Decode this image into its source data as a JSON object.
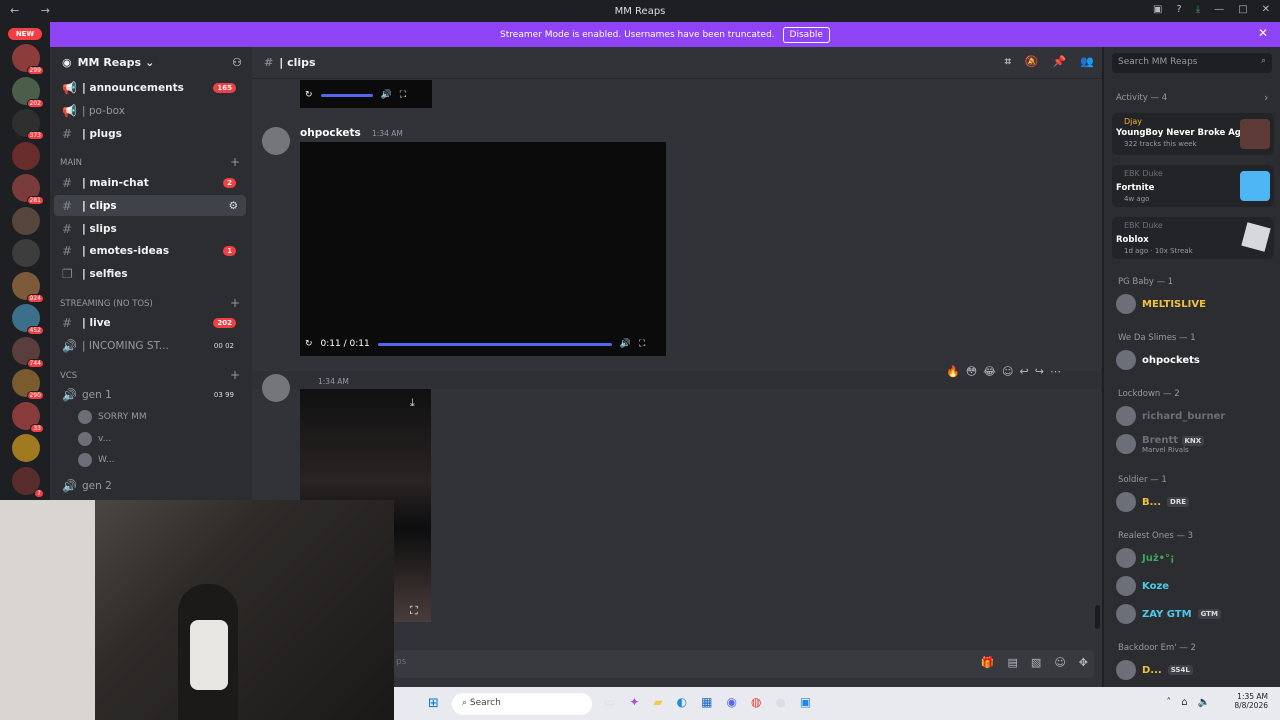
{
  "window": {
    "title": "MM Reaps",
    "nav": "← →"
  },
  "banner": {
    "text": "Streamer Mode is enabled. Usernames have been truncated.",
    "button": "Disable"
  },
  "guilds": {
    "new_label": "NEW",
    "items": [
      {
        "badge": "299"
      },
      {
        "badge": "202"
      },
      {
        "badge": "373"
      },
      {
        "badge": ""
      },
      {
        "badge": "281"
      },
      {
        "badge": ""
      },
      {
        "badge": ""
      },
      {
        "badge": "924"
      },
      {
        "badge": "452"
      },
      {
        "badge": "744"
      },
      {
        "badge": "290"
      },
      {
        "badge": "33"
      },
      {
        "badge": ""
      },
      {
        "badge": "7"
      }
    ]
  },
  "server": {
    "name": "MM Reaps"
  },
  "channels": {
    "top": [
      {
        "name": "| announcements",
        "mention": "165",
        "unread": true
      },
      {
        "name": "| po-box",
        "mention": "",
        "unread": false
      },
      {
        "name": "| plugs",
        "mention": "",
        "unread": true
      }
    ],
    "cat_main": "MAIN",
    "main": [
      {
        "name": "| main-chat",
        "mention": "2",
        "unread": true
      },
      {
        "name": "| clips",
        "mention": "",
        "unread": true,
        "selected": true
      },
      {
        "name": "| slips",
        "mention": "",
        "unread": true
      },
      {
        "name": "| emotes-ideas",
        "mention": "1",
        "unread": true
      },
      {
        "name": "| selfies",
        "mention": "",
        "unread": true
      }
    ],
    "cat_streaming": "STREAMING (NO TOS)",
    "streaming": [
      {
        "name": "| live",
        "mention": "202",
        "unread": true
      },
      {
        "name": "| INCOMING ST...",
        "mention": "",
        "unread": false,
        "counts": [
          "00",
          "02"
        ]
      }
    ],
    "cat_vcs": "VCs",
    "vc": {
      "name": "gen 1",
      "counts": [
        "03",
        "99"
      ],
      "users": [
        "SORRY MM",
        "v...",
        "W..."
      ]
    },
    "vc2": {
      "name": "gen 2"
    }
  },
  "chat": {
    "channel": "| clips",
    "messages": [
      {
        "author": "ohpockets",
        "time": "1:34 AM",
        "video_time": "0:11 / 0:11"
      },
      {
        "author": "",
        "time": "1:34 AM"
      }
    ],
    "composer_placeholder": "ps"
  },
  "members": {
    "search": "Search MM Reaps",
    "activity_label": "Activity — 4",
    "activity": [
      {
        "user": "Djay",
        "title": "YoungBoy Never Broke Again",
        "sub": "322 tracks this week"
      },
      {
        "user": "EBK Duke",
        "title": "Fortnite",
        "sub": "4w ago"
      },
      {
        "user": "EBK Duke",
        "title": "Roblox",
        "sub": "1d ago · 10x Streak"
      }
    ],
    "groups": [
      {
        "label": "PG Baby — 1",
        "members": [
          {
            "name": "MELTISLIVE",
            "color": "#f0c33c",
            "tag": ""
          }
        ]
      },
      {
        "label": "We Da Slimes — 1",
        "members": [
          {
            "name": "ohpockets",
            "color": "#ffffff",
            "tag": ""
          }
        ]
      },
      {
        "label": "Lockdown — 2",
        "members": [
          {
            "name": "richard_burner",
            "color": "#6b6f77",
            "tag": ""
          },
          {
            "name": "Brentt",
            "color": "#6b6f77",
            "tag": "KNX",
            "sub": "Marvel Rivals"
          }
        ]
      },
      {
        "label": "Soldier — 1",
        "members": [
          {
            "name": "B...",
            "color": "#f0c33c",
            "tag": "DRE"
          }
        ]
      },
      {
        "label": "Realest Ones — 3",
        "members": [
          {
            "name": "Już•°¡",
            "color": "#3ba55d",
            "tag": ""
          },
          {
            "name": "Koze",
            "color": "#4ec9e6",
            "tag": ""
          },
          {
            "name": "ZAY GTM",
            "color": "#4ec9e6",
            "tag": "GTM"
          }
        ]
      },
      {
        "label": "Backdoor Em' — 2",
        "members": [
          {
            "name": "D...",
            "color": "#f0c33c",
            "tag": "SS4L"
          }
        ]
      }
    ]
  },
  "taskbar": {
    "search": "Search",
    "time": "1:35 AM",
    "date": "8/8/2026"
  },
  "colors": {
    "accent": "#5865f2",
    "banner": "#8e44f4",
    "mention": "#f23f43"
  }
}
